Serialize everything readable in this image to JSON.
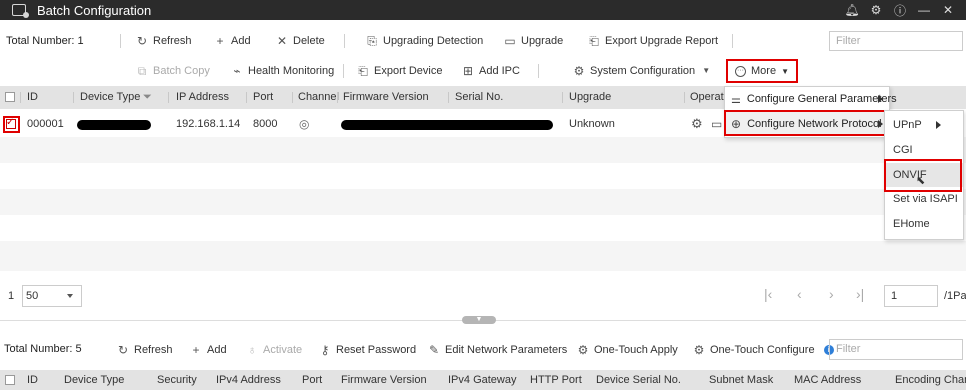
{
  "window": {
    "title": "Batch Configuration",
    "controls": [
      "bell-icon",
      "gear-icon",
      "info-icon",
      "minimize-icon",
      "close-icon"
    ]
  },
  "device_list": {
    "total_label": "Total Number: 1",
    "toolbar_row1": {
      "refresh": "Refresh",
      "add": "Add",
      "delete": "Delete",
      "upgrading_detection": "Upgrading Detection",
      "upgrade": "Upgrade",
      "export_upgrade_report": "Export Upgrade Report"
    },
    "filter_placeholder": "Filter",
    "toolbar_row2": {
      "batch_copy": "Batch Copy",
      "health_monitoring": "Health Monitoring",
      "export_device": "Export Device",
      "add_ipc": "Add IPC",
      "system_configuration": "System Configuration",
      "more": "More"
    },
    "columns": [
      "ID",
      "Device Type",
      "IP Address",
      "Port",
      "Channel",
      "Firmware Version",
      "Serial No.",
      "Upgrade",
      "Operati"
    ],
    "rows": [
      {
        "id": "000001",
        "ip": "192.168.1.14",
        "port": "8000",
        "upgrade": "Unknown",
        "checked": true
      }
    ]
  },
  "more_menu": {
    "items": [
      {
        "label": "Configure General Parameters"
      },
      {
        "label": "Configure Network Protocol"
      }
    ],
    "submenu": [
      "UPnP",
      "CGI",
      "ONVIF",
      "Set via ISAPI",
      "EHome"
    ]
  },
  "pagination": {
    "current_page_number": "1",
    "page_size": "50",
    "page_input": "1",
    "total_pages_label": "/1Pa"
  },
  "online_list": {
    "total_label": "Total Number: 5",
    "toolbar": {
      "refresh": "Refresh",
      "add": "Add",
      "activate": "Activate",
      "reset_password": "Reset Password",
      "edit_network_parameters": "Edit Network Parameters",
      "one_touch_apply": "One-Touch Apply",
      "one_touch_configure": "One-Touch Configure"
    },
    "filter_placeholder": "Filter",
    "columns": [
      "ID",
      "Device Type",
      "Security",
      "IPv4 Address",
      "Port",
      "Firmware Version",
      "IPv4 Gateway",
      "HTTP Port",
      "Device Serial No.",
      "Subnet Mask",
      "MAC Address",
      "Encoding Channe"
    ]
  },
  "colors": {
    "titlebar": "#2b2b2b",
    "highlight_red": "#e00000",
    "header_bg": "#e3e3e3",
    "info_blue": "#2f7fd8"
  }
}
